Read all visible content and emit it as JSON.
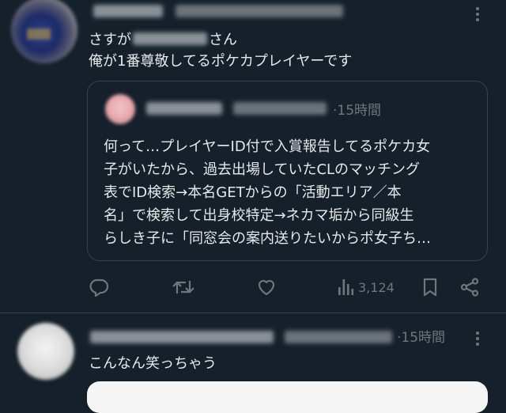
{
  "post1": {
    "text_line1_prefix": "さすが",
    "text_line1_suffix": "さん",
    "text_line2": "俺が1番尊敬してるポケカプレイヤーです",
    "quote": {
      "time": "·15時間",
      "lines": [
        "何って…プレイヤーID付で入賞報告してるポケカ女",
        "子がいたから、過去出場していたCLのマッチング",
        "表でID検索→本名GETからの「活動エリア／本",
        "名」で検索して出身校特定→ネカマ垢から同級生",
        "らしき子に「同窓会の案内送りたいからポ女子ち…"
      ]
    },
    "actions": {
      "views": "3,124"
    }
  },
  "post2": {
    "time": "·15時間",
    "text": "こんなん笑っちゃう"
  },
  "icons": {
    "more": "more-dots-icon",
    "reply": "reply-icon",
    "repost": "repost-icon",
    "like": "heart-icon",
    "views": "views-icon",
    "bookmark": "bookmark-icon",
    "share": "share-icon"
  },
  "colors": {
    "background": "#15202b",
    "text": "#e7e9ea",
    "muted": "#71767b",
    "border": "#38444d"
  }
}
